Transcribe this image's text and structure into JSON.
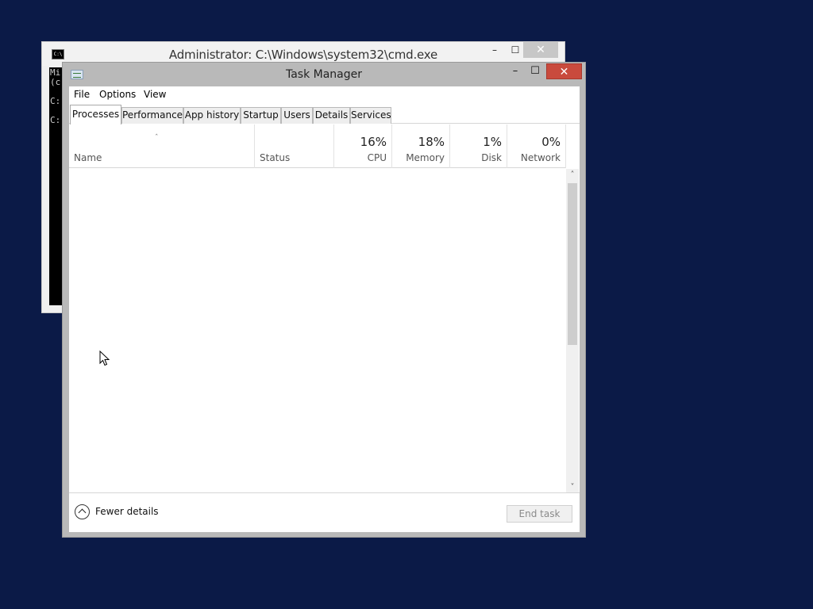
{
  "cmd_window": {
    "title": "Administrator: C:\\Windows\\system32\\cmd.exe",
    "icon_text": "C:\\",
    "console_lines": [
      "Mi",
      "(c",
      "",
      "C:",
      "",
      "C:"
    ],
    "controls": {
      "minimize": "–",
      "maximize": "☐",
      "close": "✕"
    }
  },
  "task_manager": {
    "title": "Task Manager",
    "controls": {
      "minimize": "–",
      "maximize": "☐",
      "close": "✕"
    },
    "menu": {
      "file": "File",
      "options": "Options",
      "view": "View"
    },
    "tabs": [
      {
        "label": "Processes",
        "active": true
      },
      {
        "label": "Performance",
        "active": false
      },
      {
        "label": "App history",
        "active": false
      },
      {
        "label": "Startup",
        "active": false
      },
      {
        "label": "Users",
        "active": false
      },
      {
        "label": "Details",
        "active": false
      },
      {
        "label": "Services",
        "active": false
      }
    ],
    "columns": {
      "sort_indicator": "ˆ",
      "name": {
        "label": "Name"
      },
      "status": {
        "label": "Status"
      },
      "cpu": {
        "label": "CPU",
        "value": "16%"
      },
      "memory": {
        "label": "Memory",
        "value": "18%"
      },
      "disk": {
        "label": "Disk",
        "value": "1%"
      },
      "network": {
        "label": "Network",
        "value": "0%"
      }
    },
    "processes": [],
    "scrollbar": {
      "up": "˄",
      "down": "˅"
    },
    "footer": {
      "fewer_details": "Fewer details",
      "end_task": "End task"
    }
  },
  "colors": {
    "desktop": "#0b1a47",
    "close_button": "#c94a3d",
    "window_frame": "#b9b9b9"
  }
}
